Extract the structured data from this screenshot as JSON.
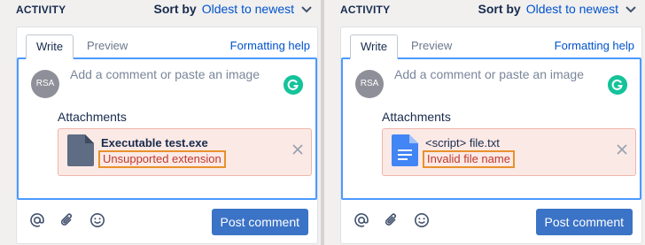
{
  "panels": [
    {
      "activity_label": "ACTIVITY",
      "sort_label": "Sort by",
      "sort_value": "Oldest to newest",
      "tabs": {
        "write": "Write",
        "preview": "Preview"
      },
      "formatting_help": "Formatting help",
      "avatar_initials": "RSA",
      "placeholder": "Add a comment or paste an image",
      "attachments_label": "Attachments",
      "attachment": {
        "file_name": "Executable test.exe",
        "error": "Unsupported extension",
        "icon": "generic-file-icon"
      },
      "post_button": "Post comment"
    },
    {
      "activity_label": "ACTIVITY",
      "sort_label": "Sort by",
      "sort_value": "Oldest to newest",
      "tabs": {
        "write": "Write",
        "preview": "Preview"
      },
      "formatting_help": "Formatting help",
      "avatar_initials": "RSA",
      "placeholder": "Add a comment or paste an image",
      "attachments_label": "Attachments",
      "attachment": {
        "file_name": "<script> file.txt",
        "error": "Invalid file name",
        "icon": "document-file-icon"
      },
      "post_button": "Post comment"
    }
  ],
  "colors": {
    "accent": "#0052cc",
    "button": "#3b73c6",
    "error_text": "#c0392b",
    "error_bg": "#fbe9e6",
    "highlight": "#e8912d",
    "grammarly": "#15c39a"
  }
}
